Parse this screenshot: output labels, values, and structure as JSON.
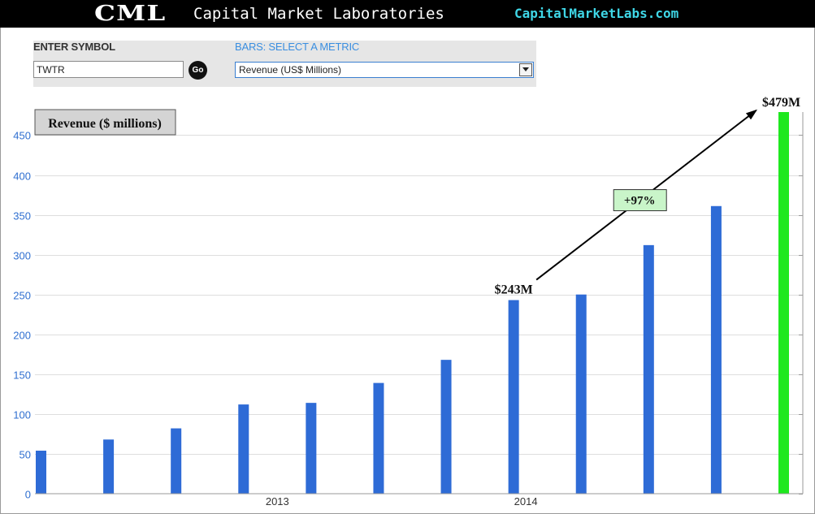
{
  "header": {
    "logo_text": "CML",
    "brand_name": "Capital Market Laboratories",
    "url": "CapitalMarketLabs.com"
  },
  "controls": {
    "symbol_label": "ENTER SYMBOL",
    "symbol_value": "TWTR",
    "go_label": "Go",
    "metric_label": "BARS: SELECT A METRIC",
    "metric_selected": "Revenue (US$ Millions)"
  },
  "colors": {
    "bar": "#2e6bd6",
    "highlight_bar": "#1fe81f",
    "accent_label": "#3a8ee0"
  },
  "chart_data": {
    "type": "bar",
    "title": "Revenue ($ millions)",
    "categories": [
      "",
      "",
      "",
      "",
      "",
      "",
      "",
      "",
      "",
      "",
      "",
      ""
    ],
    "values": [
      54,
      68,
      82,
      112,
      114,
      139,
      168,
      243,
      250,
      312,
      361,
      479
    ],
    "highlight_index": 11,
    "x_tick_labels": [
      {
        "index": 3,
        "label": "2013"
      },
      {
        "index": 7,
        "label": "2014"
      }
    ],
    "y_ticks": [
      0,
      50,
      100,
      150,
      200,
      250,
      300,
      350,
      400,
      450
    ],
    "ylim": [
      0,
      479
    ],
    "grid": true,
    "annotations": {
      "start_label": "$243M",
      "start_index": 7,
      "end_label": "$479M",
      "end_index": 11,
      "change_label": "+97%"
    }
  }
}
